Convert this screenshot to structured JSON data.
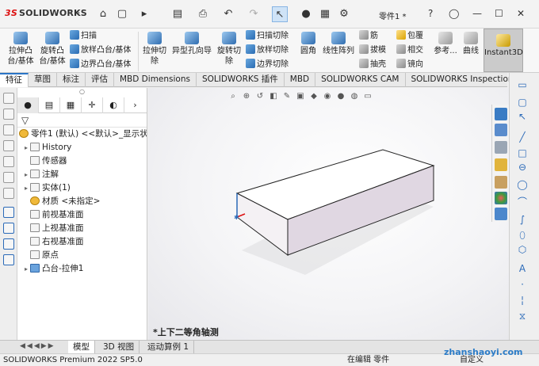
{
  "titlebar": {
    "app_logo": "SOLIDWORKS",
    "doc_title": "零件1 *",
    "icons": [
      "home-icon",
      "new-icon",
      "open-icon",
      "save-icon",
      "print-icon",
      "undo-icon",
      "redo-icon",
      "select-icon",
      "rebuild-icon",
      "file-properties-icon",
      "options-icon"
    ]
  },
  "ribbon": {
    "extrude_boss": "拉伸凸台/基体",
    "revolve_boss": "旋转凸台/基体",
    "sweep": "扫描",
    "loft": "放样凸台/基体",
    "boundary_boss": "边界凸台/基体",
    "extrude_cut": "拉伸切除",
    "hole_wizard": "异型孔向导",
    "revolve_cut": "旋转切除",
    "swept_cut": "扫描切除",
    "lofted_cut": "放样切除",
    "boundary_cut": "边界切除",
    "fillet": "圆角",
    "linear_pattern": "线性阵列",
    "rib": "筋",
    "draft": "拔模",
    "shell": "抽壳",
    "wrap": "包覆",
    "intersect": "相交",
    "mirror": "镜向",
    "reference": "参考...",
    "curves": "曲线",
    "instant3d": "Instant3D"
  },
  "tabs": [
    "特征",
    "草图",
    "标注",
    "评估",
    "MBD Dimensions",
    "SOLIDWORKS 插件",
    "MBD",
    "SOLIDWORKS CAM",
    "SOLIDWORKS Inspection"
  ],
  "feature_tree": {
    "root": "零件1 (默认) <<默认>_显示状",
    "items": [
      {
        "label": "History",
        "expandable": true
      },
      {
        "label": "传感器",
        "expandable": false
      },
      {
        "label": "注解",
        "expandable": true
      },
      {
        "label": "实体(1)",
        "expandable": true
      },
      {
        "label": "材质 <未指定>",
        "expandable": false
      },
      {
        "label": "前视基准面",
        "expandable": false
      },
      {
        "label": "上视基准面",
        "expandable": false
      },
      {
        "label": "右视基准面",
        "expandable": false
      },
      {
        "label": "原点",
        "expandable": false
      },
      {
        "label": "凸台-拉伸1",
        "expandable": true
      }
    ]
  },
  "graphics": {
    "view_label": "*上下二等角轴测"
  },
  "bottom_tabs": [
    "模型",
    "3D 视图",
    "运动算例 1"
  ],
  "status": {
    "product": "SOLIDWORKS Premium 2022 SP5.0",
    "mode": "在编辑 零件",
    "units": "自定义"
  },
  "watermark": "zhanshaoyi.com",
  "colors": {
    "accent": "#2b75c7",
    "logo_red": "#dd1111"
  }
}
